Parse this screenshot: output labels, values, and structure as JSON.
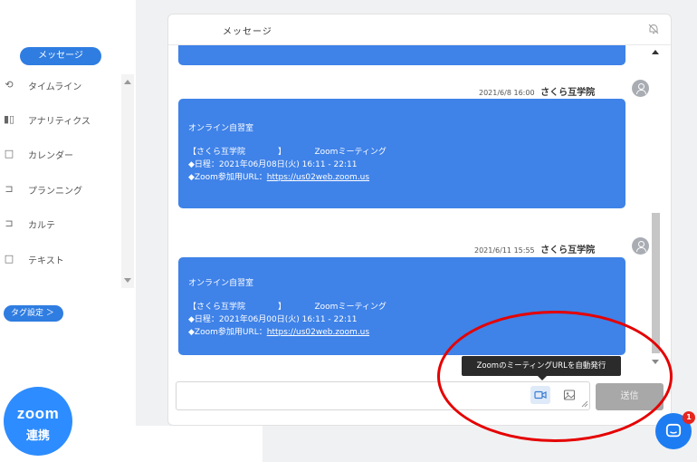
{
  "sidebar": {
    "active_label": "メッセージ",
    "items": [
      {
        "label": "タイムライン",
        "icon": "timeline-icon"
      },
      {
        "label": "アナリティクス",
        "icon": "analytics-icon"
      },
      {
        "label": "カレンダー",
        "icon": "calendar-icon"
      },
      {
        "label": "プランニング",
        "icon": "planning-icon"
      },
      {
        "label": "カルテ",
        "icon": "chart-record-icon"
      },
      {
        "label": "テキスト",
        "icon": "text-icon"
      }
    ],
    "tag_button_label": "タグ設定 ＞"
  },
  "chat": {
    "title": "メッセージ",
    "messages": [
      {
        "timestamp": "2021/6/8 16:00",
        "sender": "さくら互学院",
        "line1": "オンライン自習室",
        "line2": "【さくら互学院　　　　】　　　　Zoomミーティング",
        "line3": "◆日程：2021年06月08日(火) 16:11 - 22:11",
        "line4_prefix": "◆Zoom参加用URL：",
        "link": "https://us02web.zoom.us"
      },
      {
        "timestamp": "2021/6/11 15:55",
        "sender": "さくら互学院",
        "line1": "オンライン自習室",
        "line2": "【さくら互学院　　　　】　　　　Zoomミーティング",
        "line3": "◆日程：2021年06月00日(火) 16:11 - 22:11",
        "line4_prefix": "◆Zoom参加用URL：",
        "link": "https://us02web.zoom.us"
      }
    ],
    "tooltip": "ZoomのミーティングURLを自動発行",
    "send_label": "送信"
  },
  "zoom_badge": {
    "line1": "zoom",
    "line2": "連携"
  },
  "launcher": {
    "badge_count": "1"
  },
  "colors": {
    "accent": "#2f7de1",
    "bubble": "#3f82e8",
    "highlight": "#e50000",
    "zoom_blue": "#2d8cff"
  }
}
